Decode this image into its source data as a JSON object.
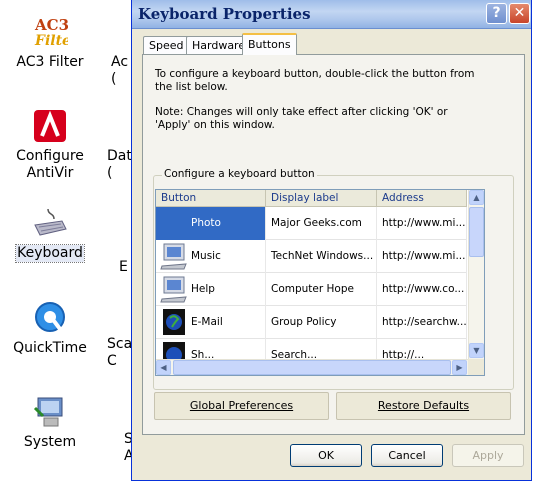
{
  "desktop": {
    "items": [
      {
        "label": "AC3 Filter",
        "icon": "ac3-filter-icon"
      },
      {
        "label": "Configure\nAntiVir",
        "icon": "antivir-umbrella-icon"
      },
      {
        "label": "Keyboard",
        "icon": "keyboard-icon",
        "selected": true
      },
      {
        "label": "QuickTime",
        "icon": "quicktime-icon"
      },
      {
        "label": "System",
        "icon": "system-computer-icon"
      }
    ],
    "fragments": [
      "Ac\n(",
      "Dat\n(",
      "E",
      "Sca\nC",
      "S\nA"
    ]
  },
  "dialog": {
    "title": "Keyboard Properties",
    "help_glyph": "?",
    "close_glyph": "✕",
    "tabs": [
      "Speed",
      "Hardware",
      "Buttons"
    ],
    "active_tab": "Buttons",
    "description": "To configure a keyboard button, double-click the button from the list below.",
    "note": "Note:  Changes will only take effect after clicking 'OK' or 'Apply' on this window.",
    "group_title": "Configure a keyboard button",
    "columns": [
      "Button",
      "Display label",
      "Address"
    ],
    "rows": [
      {
        "button": "Photo",
        "label": "Major Geeks.com",
        "address": "http://www.mi...",
        "icon": "computer-icon",
        "selected": true
      },
      {
        "button": "Music",
        "label": "TechNet Windows...",
        "address": "http://www.mi...",
        "icon": "computer-icon"
      },
      {
        "button": "Help",
        "label": "Computer Hope",
        "address": "http://www.co...",
        "icon": "computer-icon"
      },
      {
        "button": "E-Mail",
        "label": "Group Policy",
        "address": "http://searchw...",
        "icon": "globe-icon"
      },
      {
        "button": "Sh...",
        "label": "Search...",
        "address": "http://...",
        "icon": "globe-icon"
      }
    ],
    "buttons": {
      "global_prefs": "Global Preferences",
      "restore_defaults": "Restore Defaults",
      "ok": "OK",
      "cancel": "Cancel",
      "apply": "Apply"
    }
  },
  "colors": {
    "selection": "#316ac5",
    "dialog_bg": "#ece9d8",
    "title_text": "#0a246a"
  }
}
